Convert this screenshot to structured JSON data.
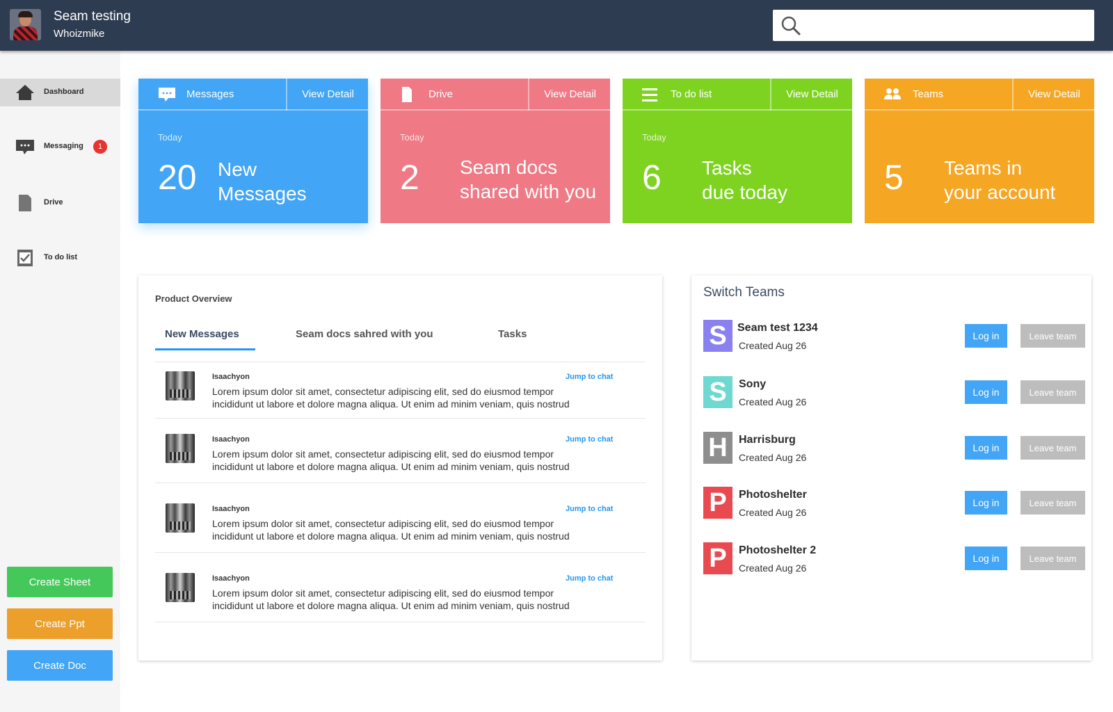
{
  "header": {
    "user_name": "Seam testing",
    "user_handle": "Whoizmike",
    "search_placeholder": ""
  },
  "sidebar": {
    "items": [
      {
        "label": "Dashboard",
        "icon": "home-icon"
      },
      {
        "label": "Messaging",
        "icon": "chat-icon",
        "badge": "1"
      },
      {
        "label": "Drive",
        "icon": "document-icon"
      },
      {
        "label": "To do list",
        "icon": "checkbox-icon"
      }
    ],
    "buttons": {
      "create_sheet": "Create Sheet",
      "create_ppt": "Create Ppt",
      "create_doc": "Create Doc"
    }
  },
  "cards": [
    {
      "title": "Messages",
      "view": "View Detail",
      "today": "Today",
      "count": "20",
      "line1": "New",
      "line2": "Messages",
      "color": "#42a5f5",
      "icon": "chat-icon"
    },
    {
      "title": "Drive",
      "view": "View Detail",
      "today": "Today",
      "count": "2",
      "line1": "Seam docs",
      "line2": "shared with you",
      "color": "#ef7985",
      "icon": "document-icon"
    },
    {
      "title": "To do list",
      "view": "View Detail",
      "today": "Today",
      "count": "6",
      "line1": "Tasks",
      "line2": "due today",
      "color": "#7ed321",
      "icon": "menu-icon"
    },
    {
      "title": "Teams",
      "view": "View Detail",
      "today": "",
      "count": "5",
      "line1": "Teams in",
      "line2": "your account",
      "color": "#f5a623",
      "icon": "users-icon"
    }
  ],
  "overview": {
    "title": "Product Overview",
    "tabs": [
      "New Messages",
      "Seam docs sahred with you",
      "Tasks"
    ],
    "messages": [
      {
        "sender": "Isaachyon",
        "jump": "Jump to chat",
        "line1": "Lorem ipsum dolor sit amet, consectetur adipiscing elit, sed do eiusmod tempor",
        "line2": "incididunt ut labore et dolore magna aliqua. Ut enim ad minim veniam, quis nostrud"
      },
      {
        "sender": "Isaachyon",
        "jump": "Jump to chat",
        "line1": "Lorem ipsum dolor sit amet, consectetur adipiscing elit, sed do eiusmod tempor",
        "line2": "incididunt ut labore et dolore magna aliqua. Ut enim ad minim veniam, quis nostrud"
      },
      {
        "sender": "Isaachyon",
        "jump": "Jump to chat",
        "line1": "Lorem ipsum dolor sit amet, consectetur adipiscing elit, sed do eiusmod tempor",
        "line2": "incididunt ut labore et dolore magna aliqua. Ut enim ad minim veniam, quis nostrud"
      },
      {
        "sender": "Isaachyon",
        "jump": "Jump to chat",
        "line1": "Lorem ipsum dolor sit amet, consectetur adipiscing elit, sed do eiusmod tempor",
        "line2": "incididunt ut labore et dolore magna aliqua. Ut enim ad minim veniam, quis nostrud"
      }
    ]
  },
  "switch_teams": {
    "title": "Switch Teams",
    "login_label": "Log in",
    "leave_label": "Leave team",
    "teams": [
      {
        "letter": "S",
        "name": "Seam test 1234",
        "created": "Created Aug 26",
        "color": "#8b80f0"
      },
      {
        "letter": "S",
        "name": "Sony",
        "created": "Created Aug 26",
        "color": "#6fd8d0"
      },
      {
        "letter": "H",
        "name": "Harrisburg",
        "created": "Created Aug 26",
        "color": "#8e8e8e"
      },
      {
        "letter": "P",
        "name": "Photoshelter",
        "created": "Created Aug 26",
        "color": "#e84a4f"
      },
      {
        "letter": "P",
        "name": "Photoshelter 2",
        "created": "Created Aug 26",
        "color": "#e84a4f"
      }
    ]
  }
}
